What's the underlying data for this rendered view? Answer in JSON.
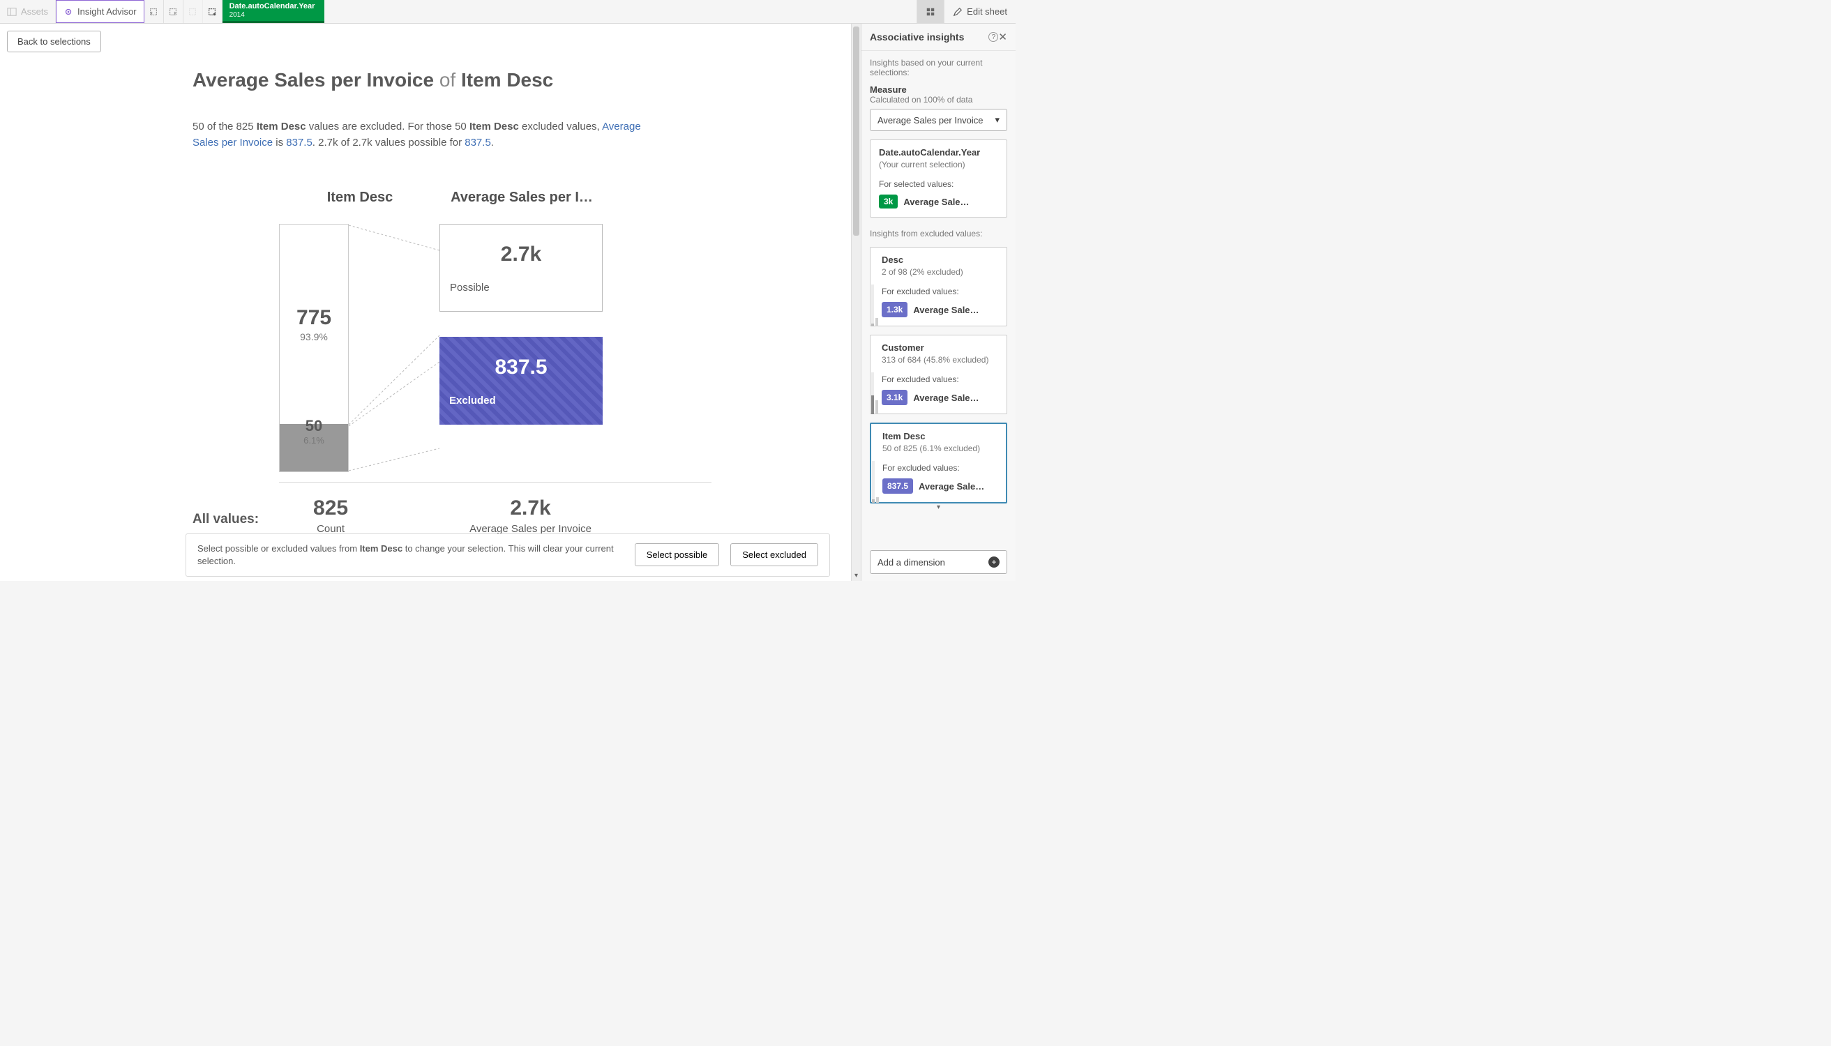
{
  "toolbar": {
    "assets": "Assets",
    "insight_advisor": "Insight Advisor",
    "selection_field": "Date.autoCalendar.Year",
    "selection_value": "2014",
    "edit_sheet": "Edit sheet"
  },
  "back_button": "Back to selections",
  "title_prefix": "Average Sales per Invoice",
  "title_middle": " of ",
  "title_subject": "Item Desc",
  "summary": {
    "p1a": "50 of the 825 ",
    "p1b": "Item Desc",
    "p1c": " values are excluded. For those 50 ",
    "p1d": "Item Desc",
    "p1e": " excluded values, ",
    "link1": "Average Sales per Invoice",
    "p2a": " is ",
    "link2": "837.5",
    "p2b": ". 2.7k of 2.7k values possible for ",
    "link3": "837.5",
    "p2c": "."
  },
  "viz": {
    "left_title": "Item Desc",
    "right_title": "Average Sales per I…",
    "included_count": "775",
    "included_pct": "93.9%",
    "excluded_count": "50",
    "excluded_pct": "6.1%",
    "possible_value": "2.7k",
    "possible_label": "Possible",
    "excluded_value": "837.5",
    "excluded_label": "Excluded"
  },
  "all_values": {
    "label": "All values:",
    "count_value": "825",
    "count_label": "Count",
    "measure_value": "2.7k",
    "measure_label": "Average Sales per Invoice"
  },
  "actions": {
    "text_a": "Select possible or excluded values from ",
    "text_bold": "Item Desc",
    "text_b": " to change your selection. This will clear your current selection.",
    "select_possible": "Select possible",
    "select_excluded": "Select excluded"
  },
  "panel": {
    "title": "Associative insights",
    "subtitle": "Insights based on your current selections:",
    "measure_label": "Measure",
    "measure_note": "Calculated on 100% of data",
    "measure_selected": "Average Sales per Invoice",
    "current": {
      "title": "Date.autoCalendar.Year",
      "subtitle": "(Your current selection)",
      "for_label": "For selected values:",
      "badge": "3k",
      "measure": "Average Sales per In…"
    },
    "excluded_header": "Insights from excluded values:",
    "cards": [
      {
        "title": "Desc",
        "sub": "2 of 98 (2% excluded)",
        "for_label": "For excluded values:",
        "badge": "1.3k",
        "measure": "Average Sales per …"
      },
      {
        "title": "Customer",
        "sub": "313 of 684 (45.8% excluded)",
        "for_label": "For excluded values:",
        "badge": "3.1k",
        "measure": "Average Sales per …"
      },
      {
        "title": "Item Desc",
        "sub": "50 of 825 (6.1% excluded)",
        "for_label": "For excluded values:",
        "badge": "837.5",
        "measure": "Average Sales pe…"
      }
    ],
    "add_dimension": "Add a dimension"
  },
  "chart_data": {
    "type": "bar",
    "title": "Item Desc breakdown and Average Sales per Invoice",
    "dimension": "Item Desc",
    "measure": "Average Sales per Invoice",
    "total_count": 825,
    "segments": [
      {
        "name": "Possible",
        "count": 775,
        "pct": 93.9,
        "measure_value": 2700
      },
      {
        "name": "Excluded",
        "count": 50,
        "pct": 6.1,
        "measure_value": 837.5
      }
    ],
    "all_values_measure": 2700
  }
}
